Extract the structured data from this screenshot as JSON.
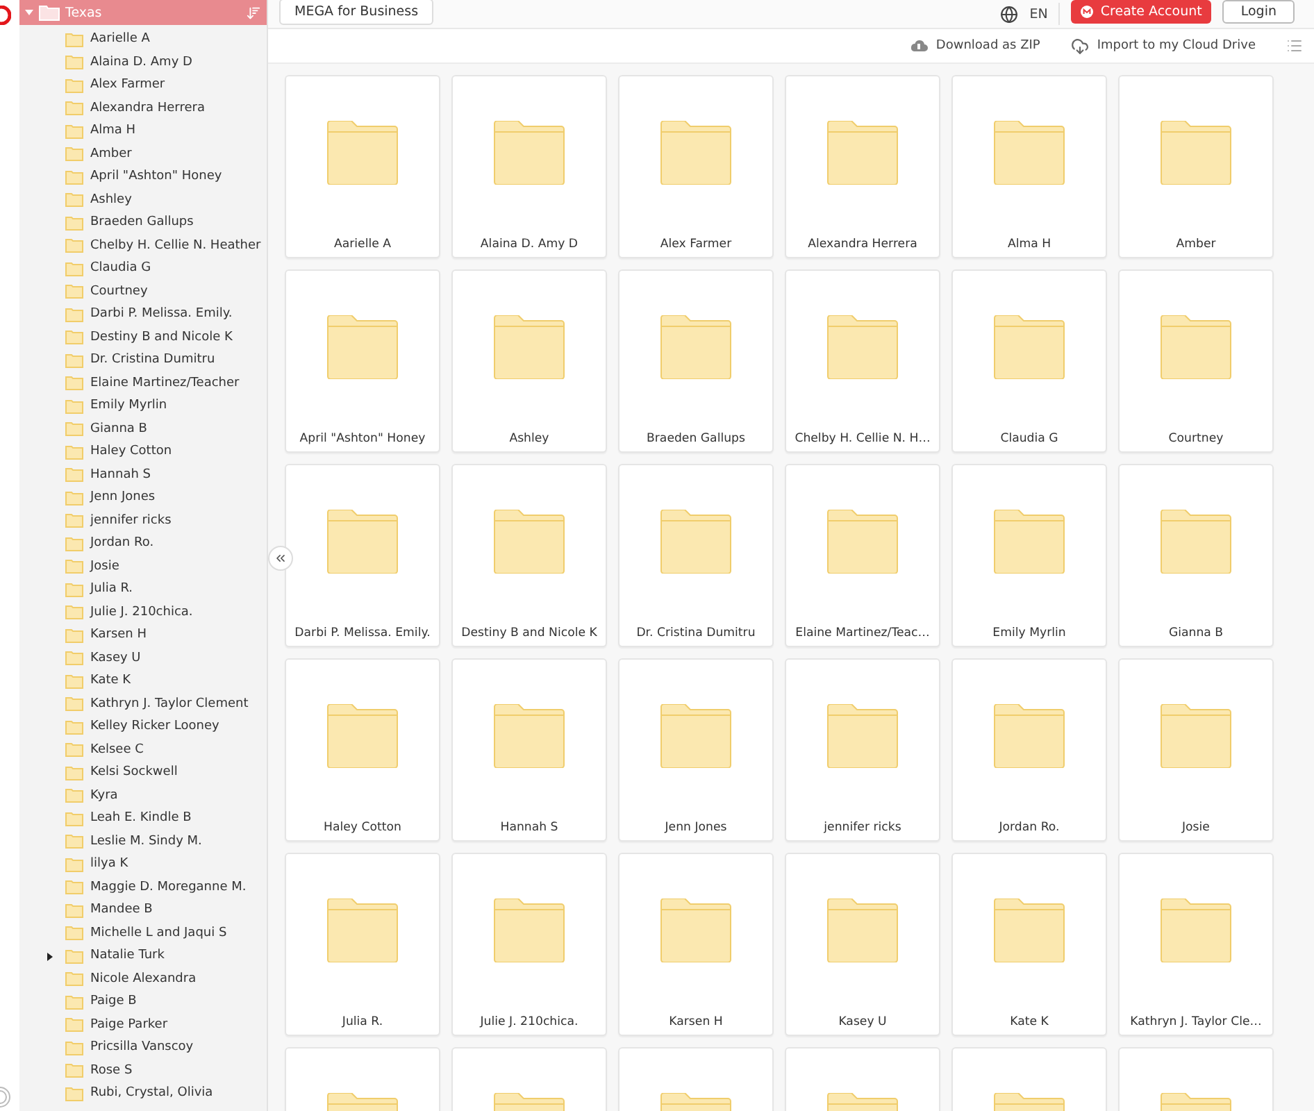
{
  "sidebar": {
    "root": {
      "label": "Texas",
      "expanded": true,
      "children": [
        {
          "label": "Aarielle A",
          "expandable": false
        },
        {
          "label": "Alaina D. Amy D",
          "expandable": false
        },
        {
          "label": "Alex Farmer",
          "expandable": false
        },
        {
          "label": "Alexandra Herrera",
          "expandable": false
        },
        {
          "label": "Alma H",
          "expandable": false
        },
        {
          "label": "Amber",
          "expandable": false
        },
        {
          "label": "April \"Ashton\" Honey",
          "expandable": false
        },
        {
          "label": "Ashley",
          "expandable": false
        },
        {
          "label": "Braeden Gallups",
          "expandable": false
        },
        {
          "label": "Chelby H. Cellie N. Heather",
          "expandable": false
        },
        {
          "label": "Claudia G",
          "expandable": false
        },
        {
          "label": "Courtney",
          "expandable": false
        },
        {
          "label": "Darbi P. Melissa. Emily.",
          "expandable": false
        },
        {
          "label": "Destiny B and Nicole K",
          "expandable": false
        },
        {
          "label": "Dr. Cristina Dumitru",
          "expandable": false
        },
        {
          "label": "Elaine Martinez/Teacher",
          "expandable": false
        },
        {
          "label": "Emily Myrlin",
          "expandable": false
        },
        {
          "label": "Gianna B",
          "expandable": false
        },
        {
          "label": "Haley Cotton",
          "expandable": false
        },
        {
          "label": "Hannah S",
          "expandable": false
        },
        {
          "label": "Jenn Jones",
          "expandable": false
        },
        {
          "label": "jennifer ricks",
          "expandable": false
        },
        {
          "label": "Jordan Ro.",
          "expandable": false
        },
        {
          "label": "Josie",
          "expandable": false
        },
        {
          "label": "Julia R.",
          "expandable": false
        },
        {
          "label": "Julie J. 210chica.",
          "expandable": false
        },
        {
          "label": "Karsen H",
          "expandable": false
        },
        {
          "label": "Kasey U",
          "expandable": false
        },
        {
          "label": "Kate K",
          "expandable": false
        },
        {
          "label": "Kathryn J. Taylor Clement",
          "expandable": false
        },
        {
          "label": "Kelley Ricker Looney",
          "expandable": false
        },
        {
          "label": "Kelsee C",
          "expandable": false
        },
        {
          "label": "Kelsi Sockwell",
          "expandable": false
        },
        {
          "label": "Kyra",
          "expandable": false
        },
        {
          "label": "Leah E. Kindle B",
          "expandable": false
        },
        {
          "label": "Leslie M. Sindy M.",
          "expandable": false
        },
        {
          "label": "lilya K",
          "expandable": false
        },
        {
          "label": "Maggie D. Moreganne M.",
          "expandable": false
        },
        {
          "label": "Mandee B",
          "expandable": false
        },
        {
          "label": "Michelle L and Jaqui S",
          "expandable": false
        },
        {
          "label": "Natalie Turk",
          "expandable": true
        },
        {
          "label": "Nicole Alexandra",
          "expandable": false
        },
        {
          "label": "Paige B",
          "expandable": false
        },
        {
          "label": "Paige Parker",
          "expandable": false
        },
        {
          "label": "Pricsilla Vanscoy",
          "expandable": false
        },
        {
          "label": "Rose S",
          "expandable": false
        },
        {
          "label": "Rubi, Crystal, Olivia",
          "expandable": false
        }
      ]
    }
  },
  "topbar": {
    "business_button": "MEGA for Business",
    "language": "EN",
    "create_account": "Create Account",
    "login": "Login"
  },
  "actions": [
    {
      "label": "Download as ZIP",
      "kind": "zip"
    },
    {
      "label": "Import to my Cloud Drive",
      "kind": "import"
    }
  ],
  "grid": {
    "folders": [
      {
        "kind": "labelled",
        "label": "Aarielle A"
      },
      {
        "kind": "labelled",
        "label": "Alaina D. Amy D"
      },
      {
        "kind": "labelled",
        "label": "Alex Farmer"
      },
      {
        "kind": "labelled",
        "label": "Alexandra Herrera"
      },
      {
        "kind": "labelled",
        "label": "Alma H"
      },
      {
        "kind": "labelled",
        "label": "Amber"
      },
      {
        "kind": "labelled",
        "label": "April \"Ashton\" Honey"
      },
      {
        "kind": "labelled",
        "label": "Ashley"
      },
      {
        "kind": "labelled",
        "label": "Braeden Gallups"
      },
      {
        "kind": "labelled",
        "label": "Chelby H. Cellie N. H…"
      },
      {
        "kind": "labelled",
        "label": "Claudia G"
      },
      {
        "kind": "labelled",
        "label": "Courtney"
      },
      {
        "kind": "labelled",
        "label": "Darbi P. Melissa. Emily."
      },
      {
        "kind": "labelled",
        "label": "Destiny B and Nicole K"
      },
      {
        "kind": "labelled",
        "label": "Dr. Cristina Dumitru"
      },
      {
        "kind": "labelled",
        "label": "Elaine Martinez/Teac…"
      },
      {
        "kind": "labelled",
        "label": "Emily Myrlin"
      },
      {
        "kind": "labelled",
        "label": "Gianna B"
      },
      {
        "kind": "labelled",
        "label": "Haley Cotton"
      },
      {
        "kind": "labelled",
        "label": "Hannah S"
      },
      {
        "kind": "labelled",
        "label": "Jenn Jones"
      },
      {
        "kind": "labelled",
        "label": "jennifer ricks"
      },
      {
        "kind": "labelled",
        "label": "Jordan Ro."
      },
      {
        "kind": "labelled",
        "label": "Josie"
      },
      {
        "kind": "labelled",
        "label": "Julia R."
      },
      {
        "kind": "labelled",
        "label": "Julie J. 210chica."
      },
      {
        "kind": "labelled",
        "label": "Karsen H"
      },
      {
        "kind": "labelled",
        "label": "Kasey U"
      },
      {
        "kind": "labelled",
        "label": "Kate K"
      },
      {
        "kind": "labelled",
        "label": "Kathryn J. Taylor Cle…"
      },
      {
        "kind": "cut"
      },
      {
        "kind": "cut"
      },
      {
        "kind": "cut"
      },
      {
        "kind": "cut"
      },
      {
        "kind": "cut"
      },
      {
        "kind": "cut"
      }
    ]
  }
}
